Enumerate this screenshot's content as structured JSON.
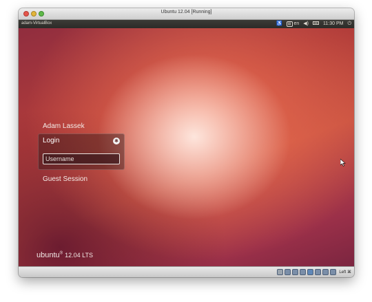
{
  "window": {
    "title": "Ubuntu 12.04 [Running]"
  },
  "panel": {
    "hostname": "adam-VirtualBox",
    "keyboard_layout": "en",
    "clock": "11:30 PM",
    "icons": [
      "accessibility-icon",
      "keyboard-icon",
      "volume-icon",
      "battery-icon",
      "power-icon"
    ]
  },
  "login": {
    "user_name": "Adam Lassek",
    "login_label": "Login",
    "username_placeholder": "Username",
    "guest_session": "Guest Session"
  },
  "branding": {
    "name": "ubuntu",
    "registered": "®",
    "version": "12.04 LTS"
  },
  "statusbar": {
    "host_key": "Left ⌘",
    "icons": [
      "hard-disk-icon",
      "optical-drive-icon",
      "usb-icon",
      "shared-folders-icon",
      "network-icon",
      "display-icon",
      "virtualization-icon",
      "mouse-integration-icon"
    ]
  },
  "colors": {
    "panel_bg": "#3c3b37",
    "accent": "#dd4814"
  }
}
